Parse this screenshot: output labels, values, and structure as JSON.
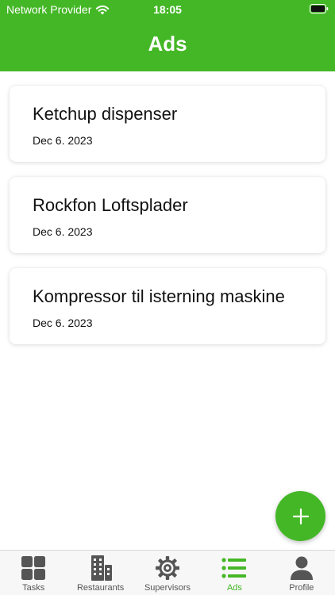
{
  "status_bar": {
    "carrier": "Network Provider",
    "time": "18:05"
  },
  "header": {
    "title": "Ads"
  },
  "ads": [
    {
      "title": "Ketchup dispenser",
      "date": "Dec 6. 2023"
    },
    {
      "title": "Rockfon Loftsplader",
      "date": "Dec 6. 2023"
    },
    {
      "title": "Kompressor til isterning maskine",
      "date": "Dec 6. 2023"
    }
  ],
  "fab": {
    "icon": "plus-icon"
  },
  "tabs": [
    {
      "label": "Tasks",
      "icon": "grid-icon",
      "active": false
    },
    {
      "label": "Restaurants",
      "icon": "building-icon",
      "active": false
    },
    {
      "label": "Supervisors",
      "icon": "gear-icon",
      "active": false
    },
    {
      "label": "Ads",
      "icon": "list-icon",
      "active": true
    },
    {
      "label": "Profile",
      "icon": "person-icon",
      "active": false
    }
  ],
  "colors": {
    "accent": "#44b726",
    "tab_inactive": "#555555"
  }
}
